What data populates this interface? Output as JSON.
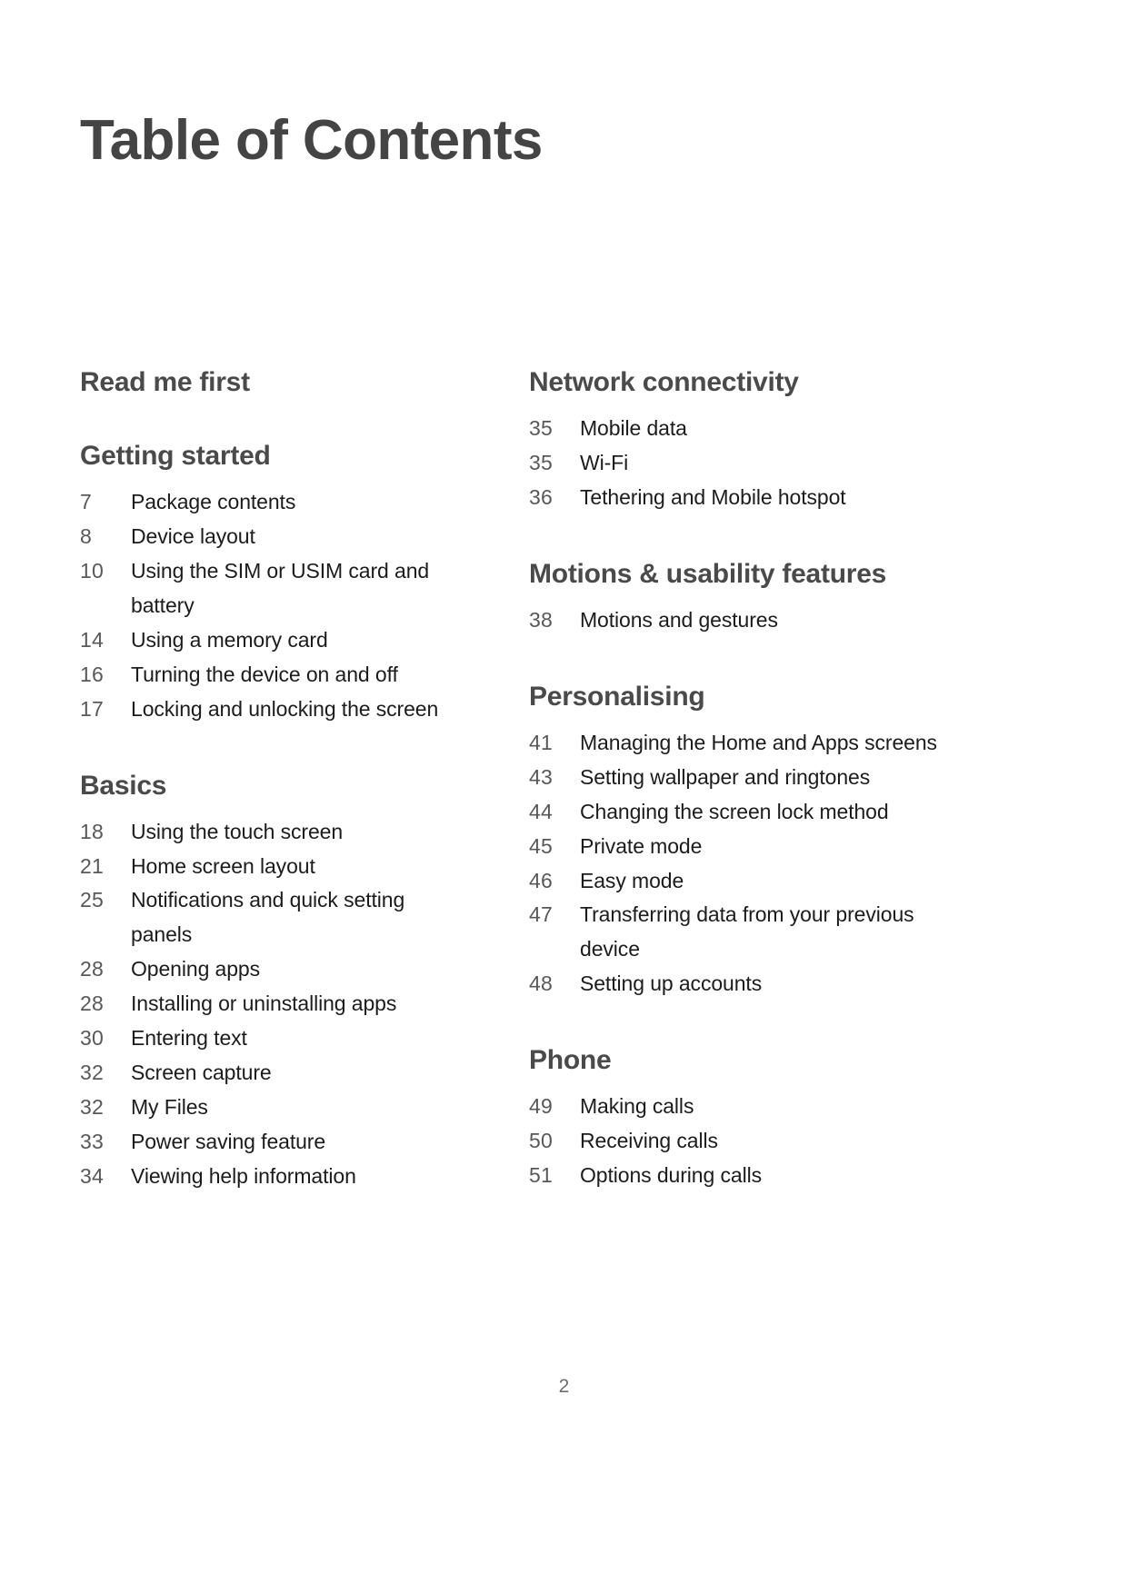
{
  "document": {
    "title": "Table of Contents",
    "page_number": "2"
  },
  "columns": {
    "left": [
      {
        "heading": "Read me first",
        "entries": []
      },
      {
        "heading": "Getting started",
        "entries": [
          {
            "page": "7",
            "title": "Package contents"
          },
          {
            "page": "8",
            "title": "Device layout"
          },
          {
            "page": "10",
            "title": "Using the SIM or USIM card and battery"
          },
          {
            "page": "14",
            "title": "Using a memory card"
          },
          {
            "page": "16",
            "title": "Turning the device on and off"
          },
          {
            "page": "17",
            "title": "Locking and unlocking the screen"
          }
        ]
      },
      {
        "heading": "Basics",
        "entries": [
          {
            "page": "18",
            "title": "Using the touch screen"
          },
          {
            "page": "21",
            "title": "Home screen layout"
          },
          {
            "page": "25",
            "title": "Notifications and quick setting panels"
          },
          {
            "page": "28",
            "title": "Opening apps"
          },
          {
            "page": "28",
            "title": "Installing or uninstalling apps"
          },
          {
            "page": "30",
            "title": "Entering text"
          },
          {
            "page": "32",
            "title": "Screen capture"
          },
          {
            "page": "32",
            "title": "My Files"
          },
          {
            "page": "33",
            "title": "Power saving feature"
          },
          {
            "page": "34",
            "title": "Viewing help information"
          }
        ]
      }
    ],
    "right": [
      {
        "heading": "Network connectivity",
        "entries": [
          {
            "page": "35",
            "title": "Mobile data"
          },
          {
            "page": "35",
            "title": "Wi-Fi"
          },
          {
            "page": "36",
            "title": "Tethering and Mobile hotspot"
          }
        ]
      },
      {
        "heading": "Motions & usability features",
        "entries": [
          {
            "page": "38",
            "title": "Motions and gestures"
          }
        ]
      },
      {
        "heading": "Personalising",
        "entries": [
          {
            "page": "41",
            "title": "Managing the Home and Apps screens"
          },
          {
            "page": "43",
            "title": "Setting wallpaper and ringtones"
          },
          {
            "page": "44",
            "title": "Changing the screen lock method"
          },
          {
            "page": "45",
            "title": "Private mode"
          },
          {
            "page": "46",
            "title": "Easy mode"
          },
          {
            "page": "47",
            "title": "Transferring data from your previous device"
          },
          {
            "page": "48",
            "title": "Setting up accounts"
          }
        ]
      },
      {
        "heading": "Phone",
        "entries": [
          {
            "page": "49",
            "title": "Making calls"
          },
          {
            "page": "50",
            "title": "Receiving calls"
          },
          {
            "page": "51",
            "title": "Options during calls"
          }
        ]
      }
    ]
  }
}
